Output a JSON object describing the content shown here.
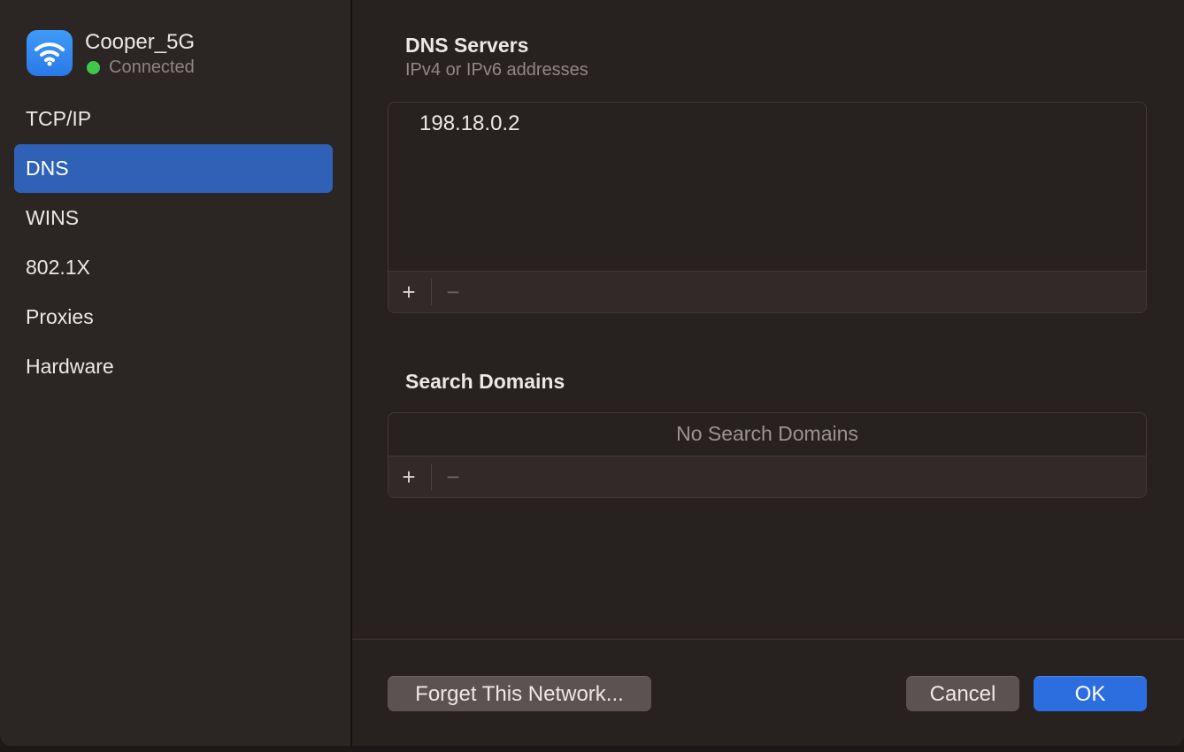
{
  "network": {
    "name": "Cooper_5G",
    "status": "Connected",
    "icon": "wifi-icon",
    "status_color": "#3ec94b"
  },
  "sidebar": {
    "items": [
      {
        "label": "TCP/IP",
        "active": false
      },
      {
        "label": "DNS",
        "active": true
      },
      {
        "label": "WINS",
        "active": false
      },
      {
        "label": "802.1X",
        "active": false
      },
      {
        "label": "Proxies",
        "active": false
      },
      {
        "label": "Hardware",
        "active": false
      }
    ],
    "active_color": "#2f62b7"
  },
  "dns_servers": {
    "title": "DNS Servers",
    "subtitle": "IPv4 or IPv6 addresses",
    "entries": [
      "198.18.0.2"
    ],
    "add_label": "+",
    "remove_label": "−"
  },
  "search_domains": {
    "title": "Search Domains",
    "empty_message": "No Search Domains",
    "add_label": "+",
    "remove_label": "−"
  },
  "footer": {
    "forget_label": "Forget This Network...",
    "cancel_label": "Cancel",
    "ok_label": "OK",
    "accent_color": "#2c6ee0"
  }
}
